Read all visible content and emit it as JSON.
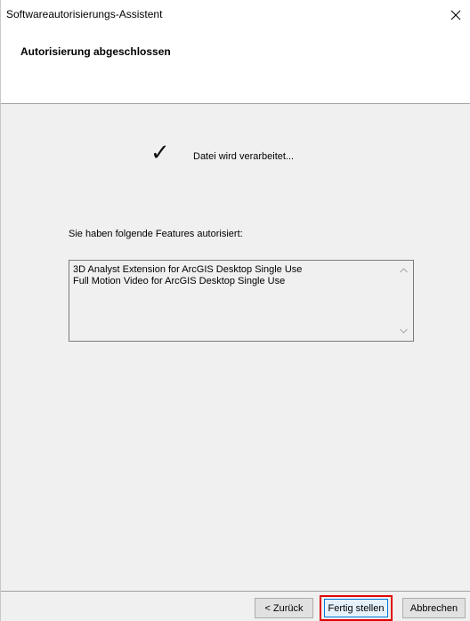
{
  "window": {
    "title": "Softwareautorisierungs-Assistent"
  },
  "header": {
    "title": "Autorisierung abgeschlossen"
  },
  "content": {
    "status_text": "Datei wird verarbeitet...",
    "features_label": "Sie haben folgende Features autorisiert:",
    "features": [
      "3D Analyst Extension for ArcGIS Desktop Single Use",
      "Full Motion Video for ArcGIS Desktop Single Use"
    ]
  },
  "footer": {
    "back_label": "< Zurück",
    "finish_label": "Fertig stellen",
    "cancel_label": "Abbrechen"
  },
  "icons": {
    "close": "close-icon",
    "check": "checkmark-icon",
    "scroll_up": "chevron-up-icon",
    "scroll_down": "chevron-down-icon"
  },
  "colors": {
    "highlight_border": "#e00000",
    "default_button_border": "#0078d7",
    "dialog_background": "#f0f0f0"
  }
}
